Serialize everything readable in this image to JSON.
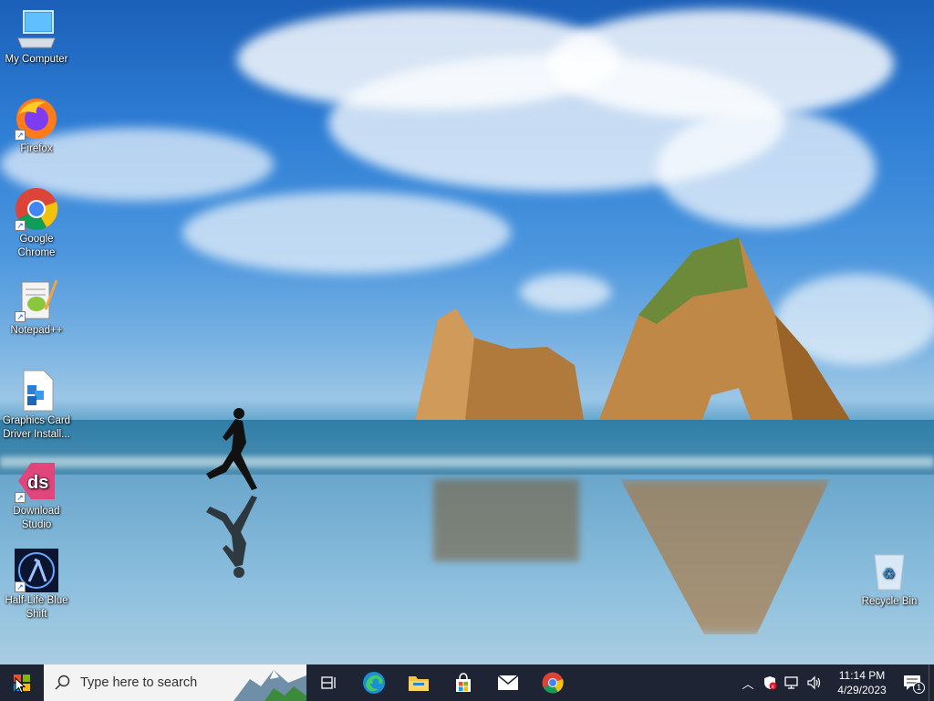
{
  "desktop": {
    "icons": [
      {
        "label": "My Computer",
        "icon": "computer-icon"
      },
      {
        "label": "Firefox",
        "icon": "firefox-icon"
      },
      {
        "label": "Google Chrome",
        "icon": "chrome-icon"
      },
      {
        "label": "Notepad++",
        "icon": "notepadpp-icon"
      },
      {
        "label": "Graphics Card Driver Install...",
        "icon": "driver-installer-icon"
      },
      {
        "label": "Download Studio",
        "icon": "download-studio-icon"
      },
      {
        "label": "Half-Life Blue Shift",
        "icon": "half-life-icon"
      },
      {
        "label": "Recycle Bin",
        "icon": "recycle-bin-icon"
      }
    ]
  },
  "taskbar": {
    "search_placeholder": "Type here to search",
    "apps": [
      "task-view-icon",
      "edge-icon",
      "file-explorer-icon",
      "store-icon",
      "mail-icon",
      "chrome-icon"
    ],
    "clock": {
      "time": "11:14 PM",
      "date": "4/29/2023"
    },
    "notification_count": "1"
  },
  "colors": {
    "taskbar_bg": "#1e2433",
    "search_bg": "#f3f3f3",
    "windows_orange": "#f2a33a"
  }
}
